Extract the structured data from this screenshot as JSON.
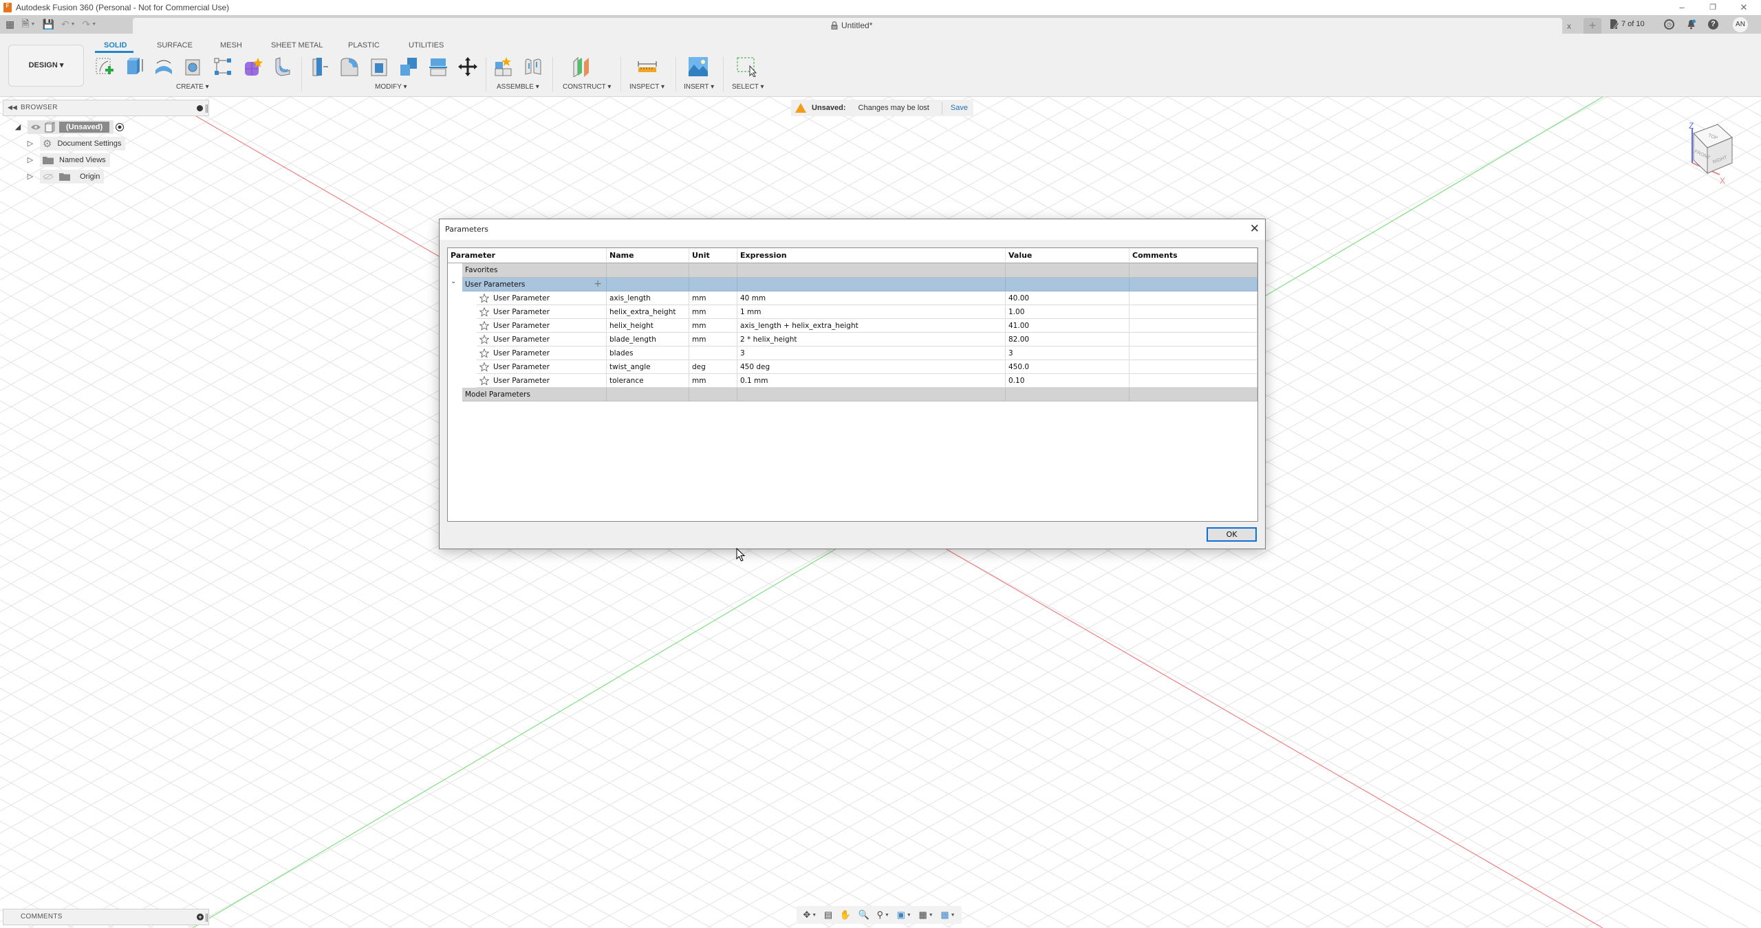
{
  "window": {
    "title": "Autodesk Fusion 360 (Personal - Not for Commercial Use)",
    "logo_letter": "F",
    "minimize": "–",
    "restore": "❐",
    "close": "✕"
  },
  "tabstrip": {
    "document_title": "Untitled*",
    "close_glyph": "x",
    "new_tab_glyph": "+",
    "jobs_status": "7 of 10",
    "avatar_initials": "AN"
  },
  "toolbar": {
    "workspace": "DESIGN ▾",
    "tabs": [
      {
        "label": "SOLID",
        "active": true
      },
      {
        "label": "SURFACE",
        "active": false
      },
      {
        "label": "MESH",
        "active": false
      },
      {
        "label": "SHEET METAL",
        "active": false
      },
      {
        "label": "PLASTIC",
        "active": false
      },
      {
        "label": "UTILITIES",
        "active": false
      }
    ],
    "groups": [
      {
        "label": "CREATE ▾"
      },
      {
        "label": "MODIFY ▾"
      },
      {
        "label": "ASSEMBLE ▾"
      },
      {
        "label": "CONSTRUCT ▾"
      },
      {
        "label": "INSPECT ▾"
      },
      {
        "label": "INSERT ▾"
      },
      {
        "label": "SELECT ▾"
      }
    ]
  },
  "browser": {
    "title": "BROWSER",
    "root_label": "(Unsaved)",
    "items": [
      {
        "label": "Document Settings",
        "icon": "gear-icon"
      },
      {
        "label": "Named Views",
        "icon": "folder-icon"
      },
      {
        "label": "Origin",
        "icon": "folder-icon"
      }
    ]
  },
  "banner": {
    "status": "Unsaved:",
    "message": "Changes may be lost",
    "action": "Save"
  },
  "viewcube": {
    "top": "TOP",
    "front": "FRONT",
    "right": "RIGHT",
    "z_axis": "Z",
    "x_axis": "X"
  },
  "comments": {
    "title": "COMMENTS",
    "add_glyph": "+"
  },
  "navbar": {
    "items": [
      "orbit",
      "look-at",
      "pan",
      "zoom",
      "fit",
      "display-settings",
      "grid-snaps",
      "viewports"
    ]
  },
  "dialog": {
    "title": "Parameters",
    "close_glyph": "✕",
    "columns": [
      "Parameter",
      "Name",
      "Unit",
      "Expression",
      "Value",
      "Comments"
    ],
    "groups": {
      "favorites": "Favorites",
      "user": "User Parameters",
      "model": "Model Parameters",
      "expander": "⌄",
      "add_glyph": "+"
    },
    "rows": [
      {
        "parameter": "User Parameter",
        "name": "axis_length",
        "unit": "mm",
        "expression": "40 mm",
        "value": "40.00",
        "comments": ""
      },
      {
        "parameter": "User Parameter",
        "name": "helix_extra_height",
        "unit": "mm",
        "expression": "1 mm",
        "value": "1.00",
        "comments": ""
      },
      {
        "parameter": "User Parameter",
        "name": "helix_height",
        "unit": "mm",
        "expression": "axis_length + helix_extra_height",
        "value": "41.00",
        "comments": ""
      },
      {
        "parameter": "User Parameter",
        "name": "blade_length",
        "unit": "mm",
        "expression": "2 * helix_height",
        "value": "82.00",
        "comments": ""
      },
      {
        "parameter": "User Parameter",
        "name": "blades",
        "unit": "",
        "expression": "3",
        "value": "3",
        "comments": ""
      },
      {
        "parameter": "User Parameter",
        "name": "twist_angle",
        "unit": "deg",
        "expression": "450 deg",
        "value": "450.0",
        "comments": ""
      },
      {
        "parameter": "User Parameter",
        "name": "tolerance",
        "unit": "mm",
        "expression": "0.1 mm",
        "value": "0.10",
        "comments": ""
      }
    ],
    "ok_label": "OK"
  },
  "colors": {
    "accent": "#1f86c7",
    "selected_row": "#a9c4dd",
    "group_row": "#d3d3d3",
    "warning": "#f39c1a",
    "x_axis": "#f08080",
    "y_axis": "#7fe07f",
    "z_axis": "#5a6cf0"
  }
}
